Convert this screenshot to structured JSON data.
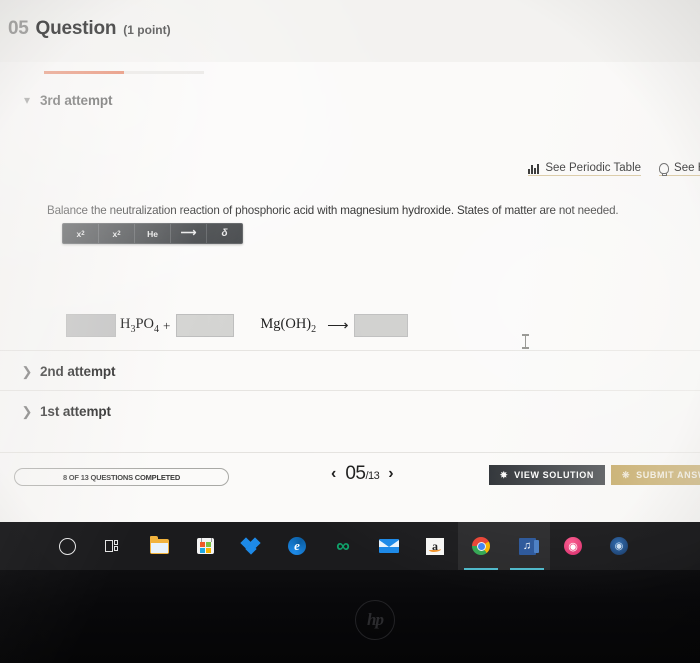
{
  "header": {
    "question_number": "05",
    "question_word": "Question",
    "points": "(1 point)"
  },
  "attempts": [
    {
      "label": "3rd attempt",
      "chevron": "chevron-down",
      "expanded": true
    },
    {
      "label": "2nd attempt",
      "chevron": "chevron-right",
      "expanded": false
    },
    {
      "label": "1st attempt",
      "chevron": "chevron-right",
      "expanded": false
    }
  ],
  "tool_links": [
    {
      "label": "See Periodic Table",
      "icon": "bar-chart-icon"
    },
    {
      "label": "See H",
      "icon": "lightbulb-icon"
    }
  ],
  "prompt": "Balance the neutralization reaction of phosphoric acid with magnesium hydroxide. States of matter are not needed.",
  "equation_toolbar": [
    {
      "name": "superscript",
      "glyph": "x",
      "script": "2",
      "script_type": "sup"
    },
    {
      "name": "subscript",
      "glyph": "x",
      "script": "2",
      "script_type": "sub"
    },
    {
      "name": "element-picker",
      "glyph": "He",
      "script": "",
      "script_type": ""
    },
    {
      "name": "reaction-arrow",
      "glyph": "⟶",
      "script": "",
      "script_type": ""
    },
    {
      "name": "charge-delta",
      "glyph": "δ",
      "script": "",
      "script_type": ""
    }
  ],
  "equation": {
    "coefficient_1": "",
    "reactant_1": "H3PO4",
    "reactant_1_parts": [
      {
        "t": "H",
        "sub": false
      },
      {
        "t": "3",
        "sub": true
      },
      {
        "t": "PO",
        "sub": false
      },
      {
        "t": "4",
        "sub": true
      }
    ],
    "plus": "+",
    "coefficient_2": "",
    "reactant_2_parts": [
      {
        "t": "Mg(OH)",
        "sub": false
      },
      {
        "t": "2",
        "sub": true
      }
    ],
    "arrow": "⟶",
    "product_blank": ""
  },
  "footer": {
    "completed_text": "8 OF 13 QUESTIONS COMPLETED",
    "prev_arrow": "‹",
    "next_arrow": "›",
    "page_current": "05",
    "page_total": "/13",
    "view_solution_label": "VIEW SOLUTION",
    "view_solution_icon": "key-icon",
    "submit_label": "SUBMIT ANSW",
    "submit_icon": "paw-icon"
  },
  "taskbar": [
    {
      "name": "cortana",
      "label": "Cortana"
    },
    {
      "name": "task-view",
      "label": "Task View"
    },
    {
      "name": "file-explorer",
      "label": "File Explorer"
    },
    {
      "name": "microsoft-store",
      "label": "Microsoft Store"
    },
    {
      "name": "dropbox",
      "label": "Dropbox"
    },
    {
      "name": "edge",
      "label": "Microsoft Edge",
      "glyph": "e"
    },
    {
      "name": "infinity",
      "label": "Infinity App",
      "glyph": "∞"
    },
    {
      "name": "mail",
      "label": "Mail"
    },
    {
      "name": "amazon",
      "label": "Amazon",
      "glyph": "a"
    },
    {
      "name": "chrome",
      "label": "Google Chrome"
    },
    {
      "name": "word",
      "label": "Microsoft Word",
      "glyph": "W"
    },
    {
      "name": "itunes",
      "label": "iTunes",
      "glyph": "♫"
    },
    {
      "name": "blue-app",
      "label": "Blue App",
      "glyph": "◉"
    }
  ],
  "device": {
    "brand_logo": "hp"
  },
  "colors": {
    "accent_orange": "#e0613a",
    "submit_gold": "#b8953f",
    "solution_dark": "#22262b",
    "link_underline": "#d9c9a4"
  }
}
